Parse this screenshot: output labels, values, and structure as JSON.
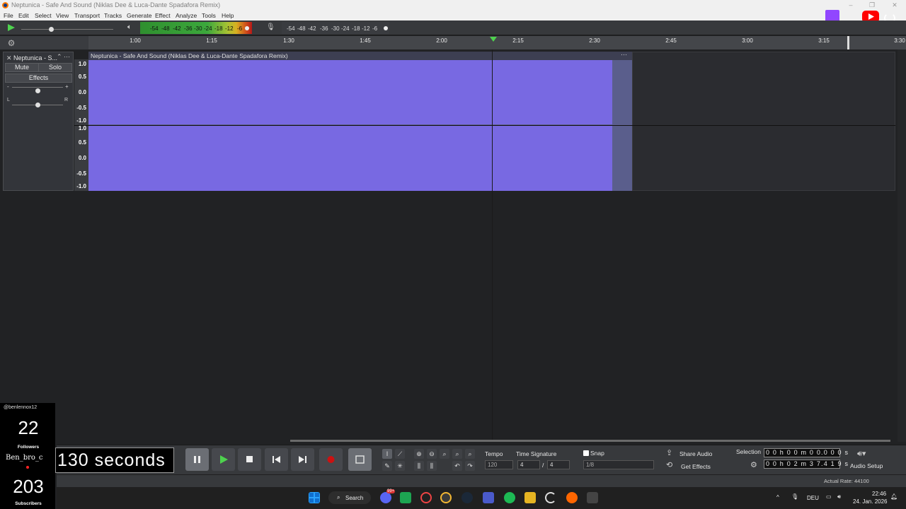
{
  "window": {
    "title": "Neptunica - Safe And Sound (Niklas Dee & Luca-Dante Spadafora Remix)",
    "controls": [
      "–",
      "❐",
      "✕"
    ]
  },
  "menu": [
    "File",
    "Edit",
    "Select",
    "View",
    "Transport",
    "Tracks",
    "Generate",
    "Effect",
    "Analyze",
    "Tools",
    "Help"
  ],
  "meters": {
    "play_labels": [
      "-54",
      "-48",
      "-42",
      "-36",
      "-30",
      "-24",
      "-18",
      "-12",
      "-6"
    ],
    "rec_labels": [
      "-54",
      "-48",
      "-42",
      "-36",
      "-30",
      "-24",
      "-18",
      "-12",
      "-6"
    ],
    "lr": [
      "L",
      "R"
    ]
  },
  "timeline": {
    "ticks": [
      "1:00",
      "1:15",
      "1:30",
      "1:45",
      "2:00",
      "2:15",
      "2:30",
      "2:45",
      "3:00",
      "3:15",
      "3:30"
    ]
  },
  "track": {
    "name": "Neptunica - S...",
    "mute": "Mute",
    "solo": "Solo",
    "effects": "Effects",
    "gain_minus": "-",
    "gain_plus": "+",
    "pan_left": "L",
    "pan_right": "R",
    "clip_title": "Neptunica - Safe And Sound (Niklas Dee & Luca-Dante Spadafora Remix)",
    "clip_menu": "···",
    "scale_top": [
      "1.0",
      "0.5",
      "0.0",
      "-0.5",
      "-1.0"
    ],
    "scale_bottom": [
      "1.0",
      "0.5",
      "0.0",
      "-0.5",
      "-1.0"
    ]
  },
  "timer": {
    "value": "130 seconds"
  },
  "tempo": {
    "label": "Tempo",
    "value": "120"
  },
  "time_signature": {
    "label": "Time Signature",
    "numerator": "4",
    "slash": "/",
    "denominator": "4"
  },
  "snap": {
    "label": "Snap",
    "value": "1/8"
  },
  "share": {
    "share_label": "Share Audio",
    "effects_label": "Get Effects"
  },
  "selection": {
    "label": "Selection",
    "start": "0 0 h 0 0 m 0 0.0 0 0 s",
    "end": "0 0 h 0 2 m 3 7.4 1 9 s"
  },
  "audio_setup": {
    "label": "Audio Setup"
  },
  "status": {
    "rate": "Actual Rate: 44100"
  },
  "overlay": {
    "handle": "@benlennox12",
    "followers": "22",
    "followers_label": "Followers",
    "username": "Ben_bro_c",
    "subscribers": "203",
    "subscribers_label": "Subscribers"
  },
  "taskbar": {
    "search": "Search",
    "lang": "DEU",
    "time": "22:46",
    "date": "24. Jan. 2026",
    "badge": "99+"
  },
  "colors": {
    "waveform": "#7869e2",
    "meter_green": "#3ca83c",
    "record": "#cc1111",
    "twitch": "#9146ff",
    "youtube": "#ff0000"
  }
}
